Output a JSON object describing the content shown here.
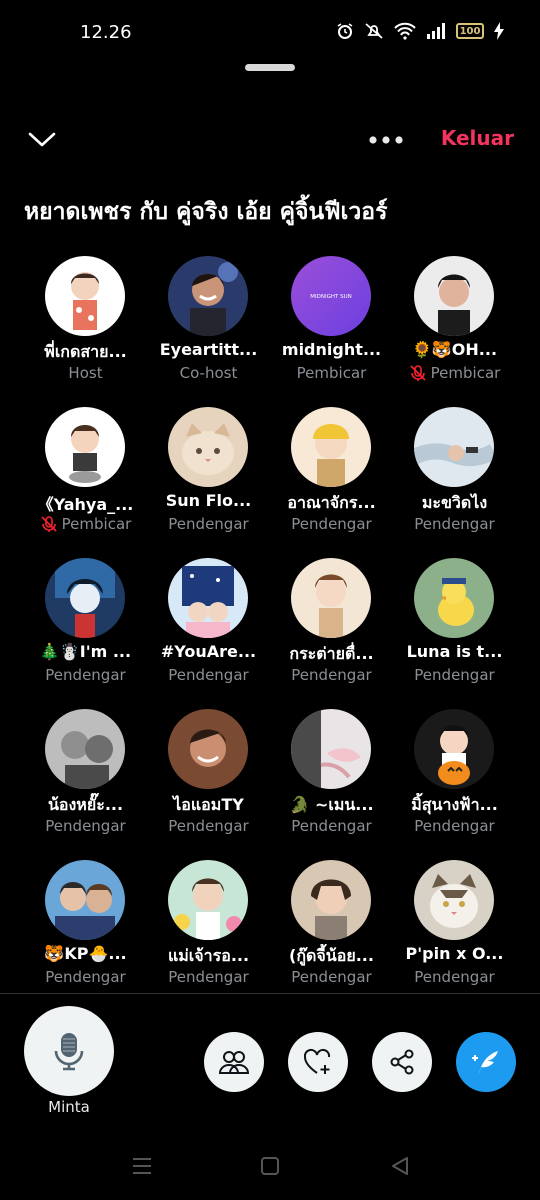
{
  "status": {
    "time": "12.26",
    "battery": "100"
  },
  "header": {
    "leave_label": "Keluar"
  },
  "space": {
    "title": "หยาดเพชร กับ คู่จริง เอ้ย คู่จิ้นฟีเวอร์"
  },
  "participants": [
    {
      "name": "พี่เกดสาย...",
      "role": "Host",
      "muted": false,
      "avatar": "cartoon-boy"
    },
    {
      "name": "Eyeartitt...",
      "role": "Co-host",
      "muted": false,
      "avatar": "man-smiling"
    },
    {
      "name": "midnight...",
      "role": "Pembicar",
      "muted": false,
      "avatar": "purple-logo",
      "avatar_text": "MIDNIGHT SUN"
    },
    {
      "name": "🌻🐯OH...",
      "role": "Pembicar",
      "muted": true,
      "avatar": "man-portrait"
    },
    {
      "name": "《Yahya_...",
      "role": "Pembicar",
      "muted": true,
      "avatar": "cartoon-sitting"
    },
    {
      "name": "Sun Flo...",
      "role": "Pendengar",
      "muted": false,
      "avatar": "cat-beige"
    },
    {
      "name": "อาณาจักร...",
      "role": "Pendengar",
      "muted": false,
      "avatar": "cartoon-helmet"
    },
    {
      "name": "มะขวิดไง",
      "role": "Pendengar",
      "muted": false,
      "avatar": "holding-hands"
    },
    {
      "name": "🎄☃️I'm ...",
      "role": "Pendengar",
      "muted": false,
      "avatar": "anime-blue"
    },
    {
      "name": "#YouAre...",
      "role": "Pendengar",
      "muted": false,
      "avatar": "illustration-window"
    },
    {
      "name": "กระต่ายตื่...",
      "role": "Pendengar",
      "muted": false,
      "avatar": "cartoon-boy2"
    },
    {
      "name": "Luna is t...",
      "role": "Pendengar",
      "muted": false,
      "avatar": "chick"
    },
    {
      "name": "น้องหยั๊ะ...",
      "role": "Pendengar",
      "muted": false,
      "avatar": "bw-photo"
    },
    {
      "name": "ไอแอมTY",
      "role": "Pendengar",
      "muted": false,
      "avatar": "man-laughing"
    },
    {
      "name": "🐊 ~เมน...",
      "role": "Pendengar",
      "muted": false,
      "avatar": "feathers"
    },
    {
      "name": "มิ้สุนางฟ้า...",
      "role": "Pendengar",
      "muted": false,
      "avatar": "cartoon-pumpkin"
    },
    {
      "name": "🐯KP🐣...",
      "role": "Pendengar",
      "muted": false,
      "avatar": "two-men"
    },
    {
      "name": "แม่เจ้ารอ...",
      "role": "Pendengar",
      "muted": false,
      "avatar": "man-flowers"
    },
    {
      "name": "(กู๊ดจี้น้อย...",
      "role": "Pendengar",
      "muted": false,
      "avatar": "man-hair"
    },
    {
      "name": "P'pin x O...",
      "role": "Pendengar",
      "muted": false,
      "avatar": "cat-tabby"
    }
  ],
  "actions": {
    "mic_label": "Minta"
  },
  "colors": {
    "accent_red": "#f4335f",
    "compose_blue": "#1d9bf0",
    "muted_red": "#f4212e",
    "subtext": "#8b8f94"
  }
}
